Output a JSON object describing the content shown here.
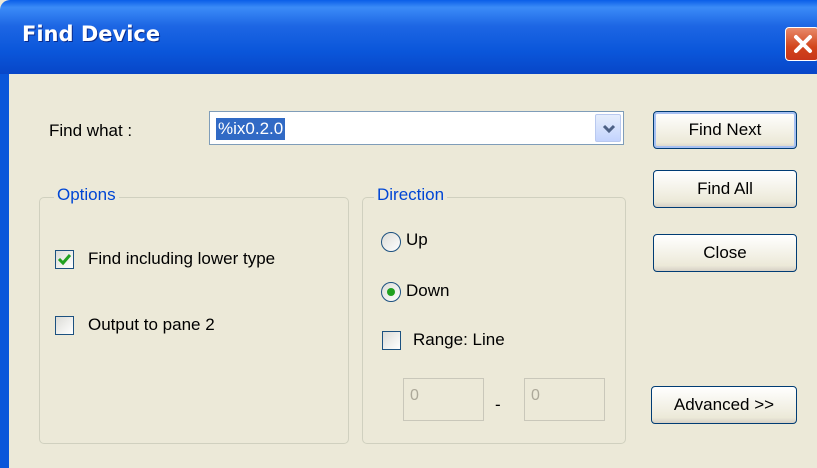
{
  "window": {
    "title": "Find Device"
  },
  "find_what": {
    "label": "Find what :",
    "value": "%ix0.2.0"
  },
  "buttons": {
    "find_next": "Find Next",
    "find_all": "Find All",
    "close": "Close",
    "advanced": "Advanced >>"
  },
  "options": {
    "legend": "Options",
    "include_lower": {
      "label": "Find including lower type",
      "checked": true
    },
    "output_pane2": {
      "label": "Output to pane 2",
      "checked": false
    }
  },
  "direction": {
    "legend": "Direction",
    "up": {
      "label": "Up",
      "selected": false
    },
    "down": {
      "label": "Down",
      "selected": true
    },
    "range": {
      "label": "Range: Line",
      "checked": false,
      "from": "0",
      "separator": "-",
      "to": "0"
    }
  },
  "colors": {
    "title_bar": "#0a56da",
    "legend_text": "#0046d5",
    "face": "#ece9d8",
    "check_mark": "#21a121",
    "close_button": "#d2441b"
  }
}
